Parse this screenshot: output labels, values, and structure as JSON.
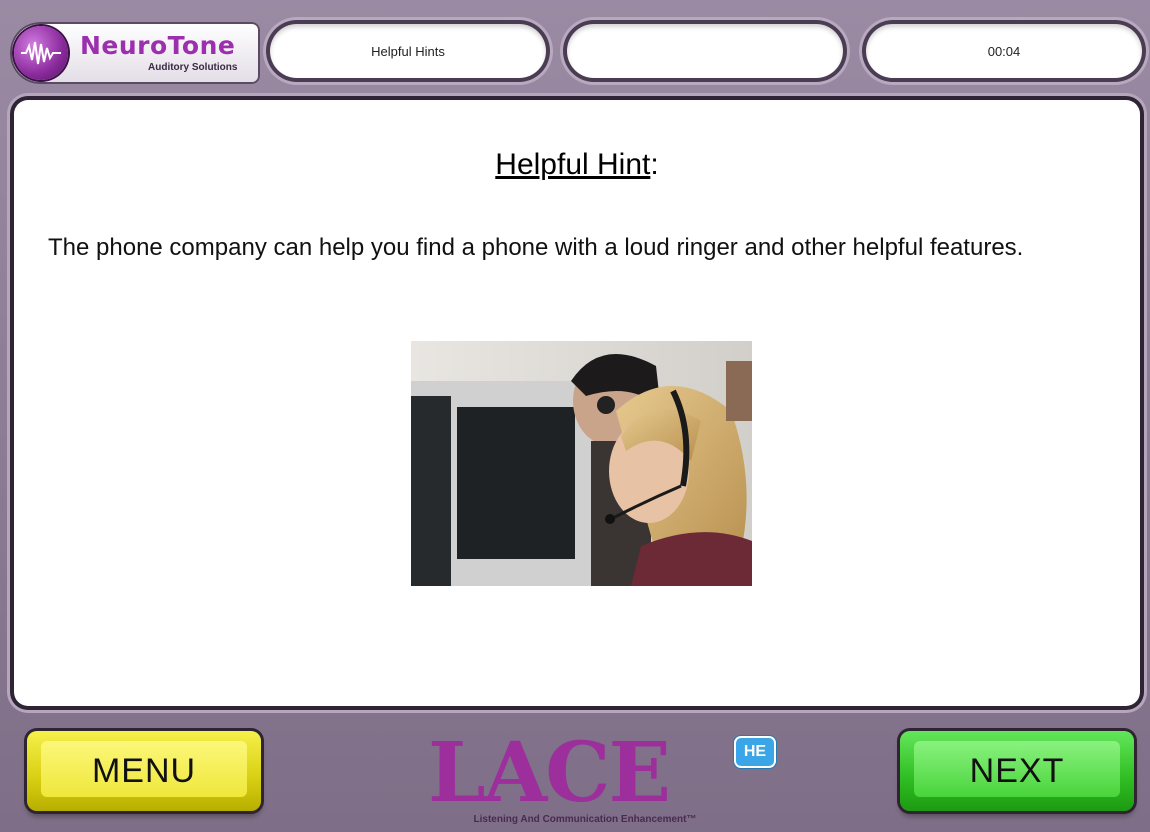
{
  "brand": {
    "name": "NeuroTone",
    "subtitle": "Auditory Solutions"
  },
  "header": {
    "section_label": "Helpful Hints",
    "middle_label": "",
    "timer": "00:04"
  },
  "content": {
    "title": "Helpful Hint",
    "title_suffix": ":",
    "text": "The phone company can help you find a phone with a loud ringer and other helpful features."
  },
  "footer": {
    "menu_label": "MENU",
    "next_label": "NEXT",
    "logo_word": "LACE",
    "logo_badge": "HE",
    "logo_tagline": "Listening And Communication Enhancement™"
  },
  "colors": {
    "frame": "#8a7a92",
    "brand_purple": "#9c2f9c",
    "menu_yellow": "#f0e830",
    "next_green": "#3fcf32",
    "badge_blue": "#3aa6e8"
  }
}
